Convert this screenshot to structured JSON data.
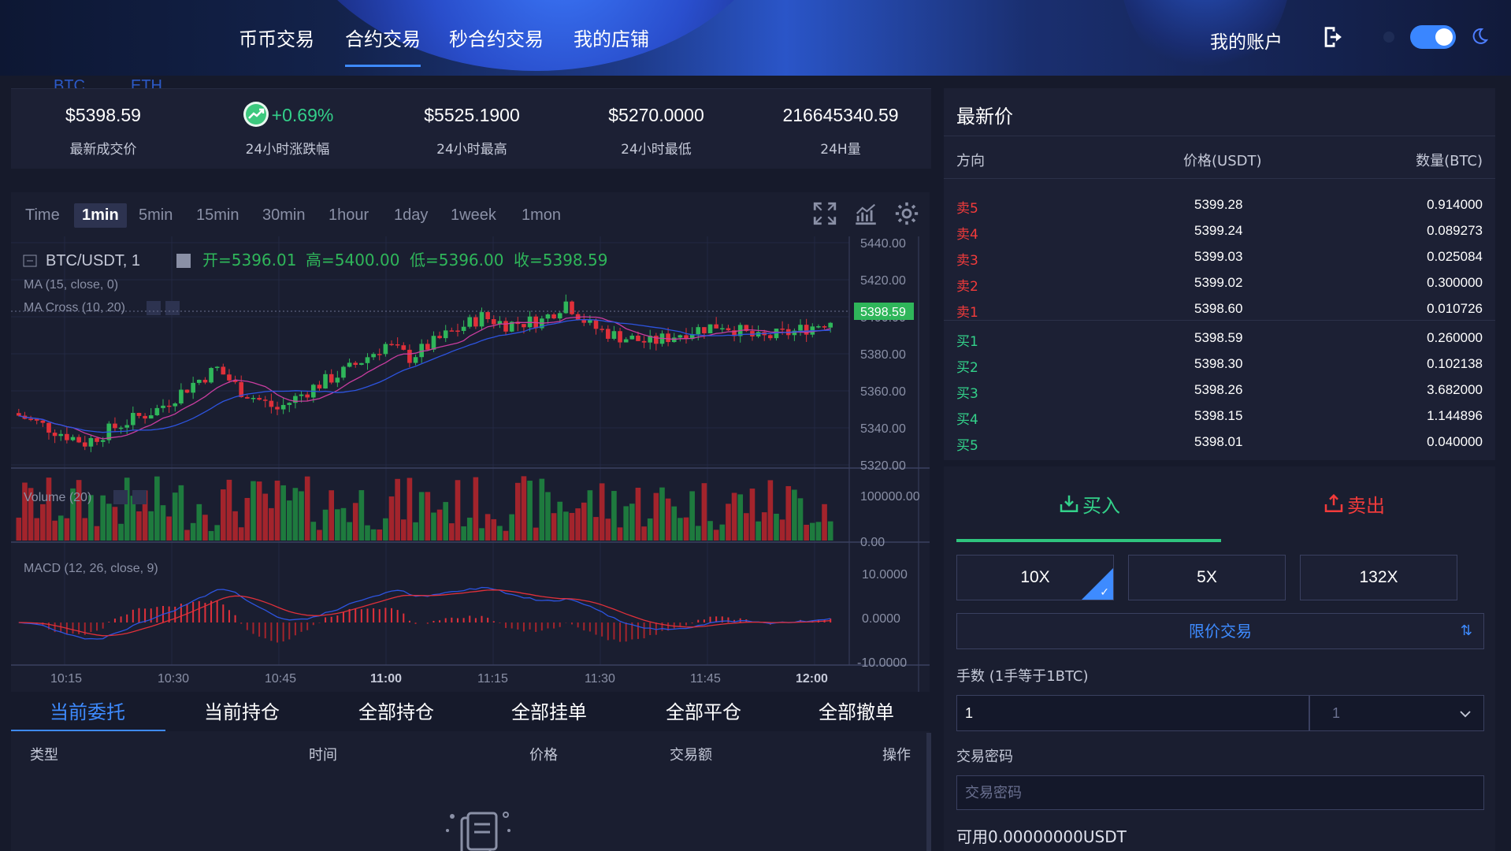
{
  "nav": {
    "items": [
      "币币交易",
      "合约交易",
      "秒合约交易",
      "我的店铺"
    ],
    "active_index": 1,
    "account_label": "我的账户",
    "logout_icon": "logout-icon",
    "theme_toggle": "on",
    "accent_color": "#3e8bff"
  },
  "coin_tabs": [
    "BTC",
    "ETH"
  ],
  "stats": [
    {
      "value": "$5398.59",
      "label": "最新成交价"
    },
    {
      "value": "+0.69%",
      "label": "24小时涨跌幅",
      "trend": "up"
    },
    {
      "value": "$5525.1900",
      "label": "24小时最高"
    },
    {
      "value": "$5270.0000",
      "label": "24小时最低"
    },
    {
      "value": "216645340.59",
      "label": "24H量"
    }
  ],
  "chart": {
    "timeframes": [
      "Time",
      "1min",
      "5min",
      "15min",
      "30min",
      "1hour",
      "1day",
      "1week",
      "1mon"
    ],
    "active_timeframe": "1min",
    "symbol": "BTC/USDT, 1",
    "ohlc": {
      "open": "开=5396.01",
      "high": "高=5400.00",
      "low": "低=5396.00",
      "close": "收=5398.59"
    },
    "indicators": [
      "MA (15, close, 0)",
      "MA Cross (10, 20)"
    ],
    "volume_label": "Volume (20)",
    "macd_label": "MACD (12, 26, close, 9)",
    "price_ticks": [
      "5440.00",
      "5420.00",
      "5400.00",
      "5380.00",
      "5360.00",
      "5340.00",
      "5320.00"
    ],
    "last_price_tag": "5398.59",
    "volume_ticks": [
      "100000.00",
      "0.00"
    ],
    "macd_ticks": [
      "10.0000",
      "0.0000",
      "-10.0000"
    ],
    "time_ticks": [
      "10:15",
      "10:30",
      "10:45",
      "11:00",
      "11:15",
      "11:30",
      "11:45",
      "12:00"
    ],
    "colors": {
      "up": "#2fb65a",
      "down": "#e0303a",
      "ma1": "#c93da0",
      "ma2": "#2d54e0"
    }
  },
  "order_tabs": [
    "当前委托",
    "当前持仓",
    "全部持仓",
    "全部挂单",
    "全部平仓",
    "全部撤单"
  ],
  "order_columns": [
    "类型",
    "时间",
    "价格",
    "交易额",
    "操作"
  ],
  "orderbook": {
    "title": "最新价",
    "headers": {
      "direction": "方向",
      "price": "价格(USDT)",
      "qty": "数量(BTC)"
    },
    "rows": [
      {
        "dir": "卖5",
        "price": "5399.28",
        "qty": "0.914000",
        "side": "sell"
      },
      {
        "dir": "卖4",
        "price": "5399.24",
        "qty": "0.089273",
        "side": "sell"
      },
      {
        "dir": "卖3",
        "price": "5399.03",
        "qty": "0.025084",
        "side": "sell"
      },
      {
        "dir": "卖2",
        "price": "5399.02",
        "qty": "0.300000",
        "side": "sell"
      },
      {
        "dir": "卖1",
        "price": "5398.60",
        "qty": "0.010726",
        "side": "sell"
      },
      {
        "dir": "买1",
        "price": "5398.59",
        "qty": "0.260000",
        "side": "buy"
      },
      {
        "dir": "买2",
        "price": "5398.30",
        "qty": "0.102138",
        "side": "buy"
      },
      {
        "dir": "买3",
        "price": "5398.26",
        "qty": "3.682000",
        "side": "buy"
      },
      {
        "dir": "买4",
        "price": "5398.15",
        "qty": "1.144896",
        "side": "buy"
      },
      {
        "dir": "买5",
        "price": "5398.01",
        "qty": "0.040000",
        "side": "buy"
      }
    ]
  },
  "trade": {
    "buy_label": "买入",
    "sell_label": "卖出",
    "leverages": [
      "10X",
      "5X",
      "132X"
    ],
    "selected_leverage": "10X",
    "order_type": "限价交易",
    "qty_label": "手数 (1手等于1BTC)",
    "qty_value": "1",
    "qty_select_value": "1",
    "password_label": "交易密码",
    "password_placeholder": "交易密码",
    "available": "可用0.00000000USDT"
  }
}
